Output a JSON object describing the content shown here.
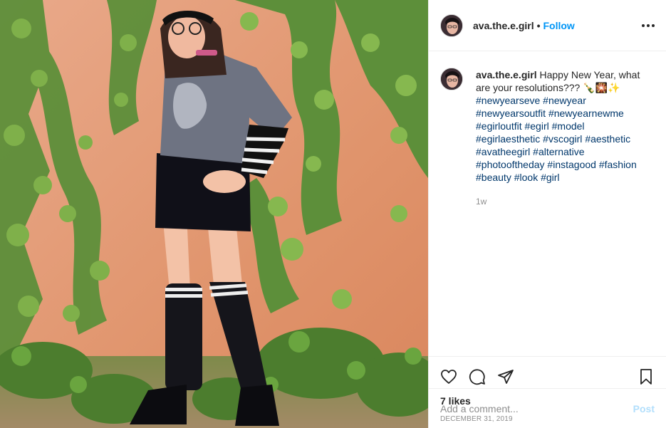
{
  "header": {
    "username": "ava.the.e.girl",
    "separator": "•",
    "follow_label": "Follow"
  },
  "caption": {
    "username": "ava.the.e.girl",
    "text": "Happy New Year, what are your resolutions??? 🍾🎇✨",
    "hashtags": [
      "#newyearseve",
      "#newyear",
      "#newyearsoutfit",
      "#newyearnewme",
      "#egirloutfit",
      "#egirl",
      "#model",
      "#egirlaesthetic",
      "#vscogirl",
      "#aesthetic",
      "#avatheegirl",
      "#alternative",
      "#photooftheday",
      "#instagood",
      "#fashion",
      "#beauty",
      "#look",
      "#girl"
    ],
    "time": "1w"
  },
  "actions": {
    "icons": [
      "heart-icon",
      "comment-icon",
      "share-icon",
      "bookmark-icon"
    ],
    "likes": "7 likes",
    "date": "DECEMBER 31, 2019"
  },
  "add_comment": {
    "placeholder": "Add a comment...",
    "post_label": "Post"
  },
  "colors": {
    "follow": "#0095f6",
    "post_disabled": "#b2dffc",
    "hashtag": "#00376b",
    "muted": "#8e8e8e",
    "border": "#efefef",
    "wall": "#e29a72"
  }
}
